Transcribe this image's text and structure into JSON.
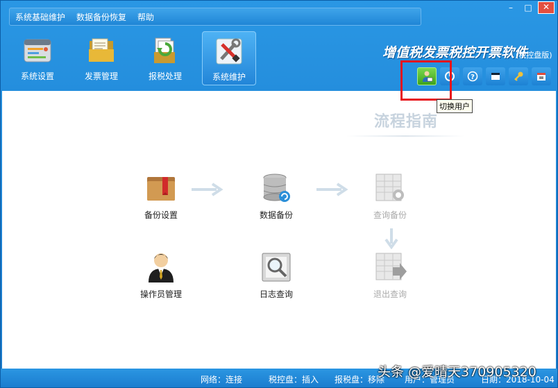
{
  "menu": {
    "items": [
      "系统基础维护",
      "数据备份恢复",
      "帮助"
    ]
  },
  "window_controls": {
    "minimize": "–",
    "maximize": "□",
    "close": "✕"
  },
  "toolbar": {
    "buttons": [
      {
        "label": "系统设置",
        "icon": "settings-panel-icon"
      },
      {
        "label": "发票管理",
        "icon": "invoice-folder-icon"
      },
      {
        "label": "报税处理",
        "icon": "tax-report-icon"
      },
      {
        "label": "系统维护",
        "icon": "tools-icon",
        "active": true
      }
    ]
  },
  "app": {
    "title": "增值税发票税控开票软件",
    "subtitle": "(税控盘版)"
  },
  "icon_bar": {
    "icons": [
      "switch-user-icon",
      "power-icon",
      "help-icon",
      "window-icon",
      "key-icon",
      "calendar-icon"
    ]
  },
  "tooltip": "切换用户",
  "guide_title": "流程指南",
  "flow": {
    "backup_settings": "备份设置",
    "data_backup": "数据备份",
    "query_backup": "查询备份",
    "operator_management": "操作员管理",
    "log_query": "日志查询",
    "exit_query": "退出查询"
  },
  "status": {
    "network": "网络：连接",
    "tax_disk": "税控盘：插入",
    "report_disk": "报税盘：移除",
    "user": "用户：管理员",
    "date": "日期：2018-10-04"
  },
  "watermark": "头条 @爱晴天370905320",
  "colors": {
    "accent": "#1e82d2",
    "highlight": "#e8141a",
    "switch_user_bg": "#5cc033"
  }
}
